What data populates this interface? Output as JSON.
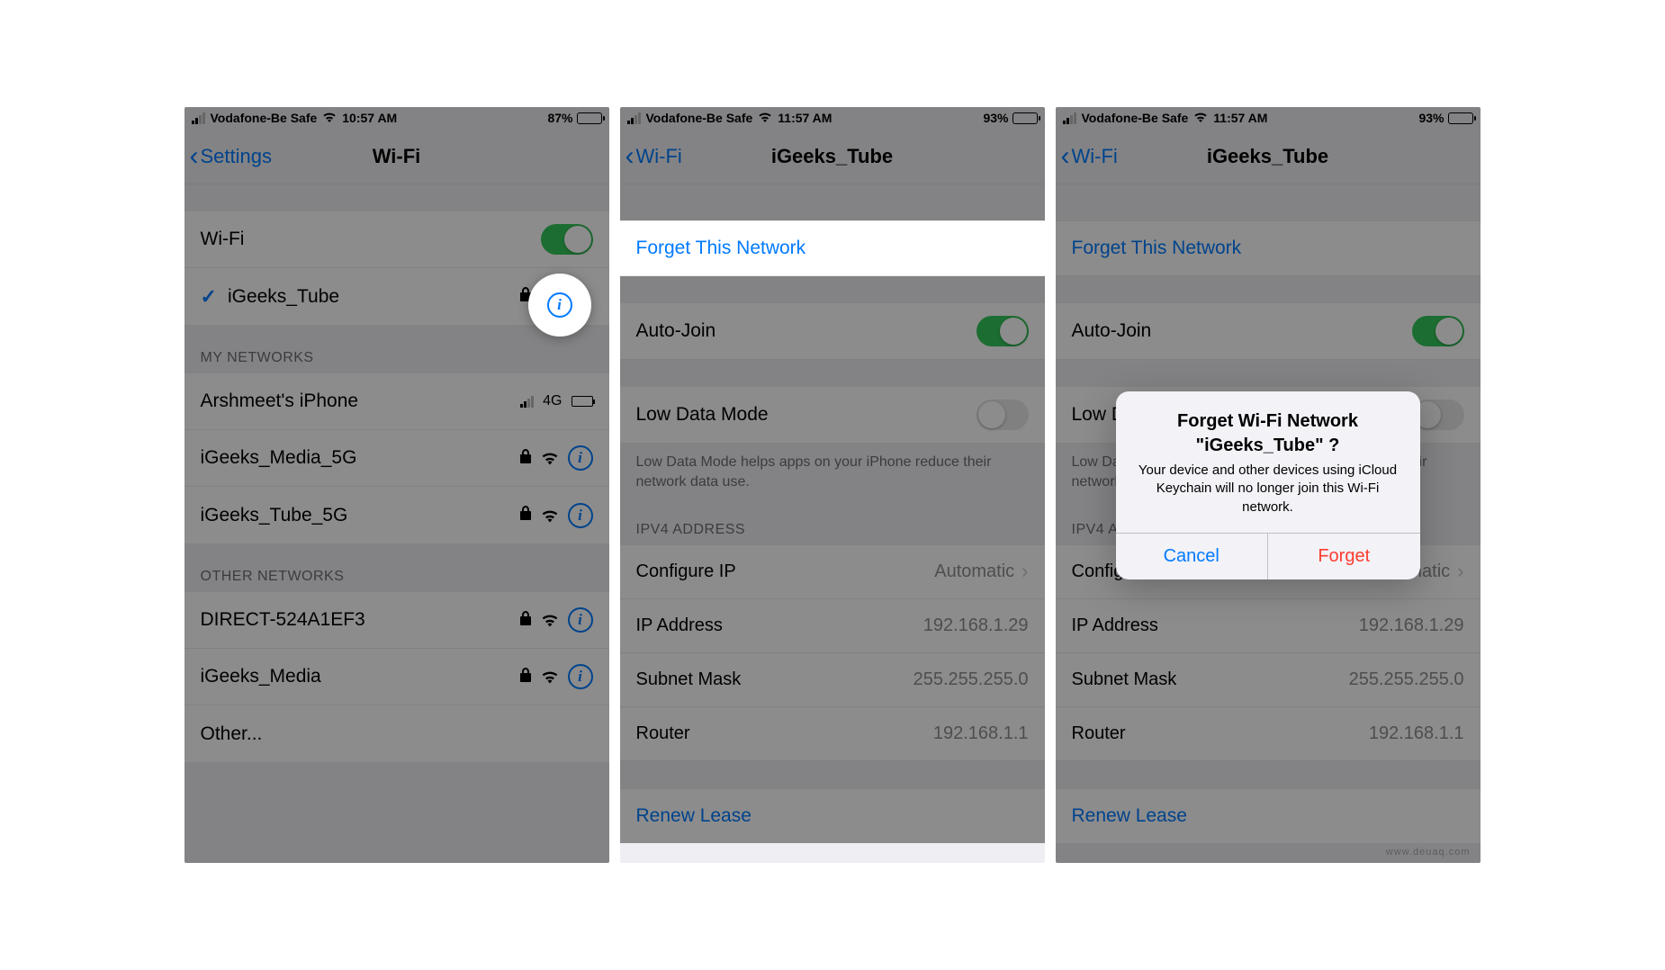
{
  "screen1": {
    "status": {
      "carrier": "Vodafone-Be Safe",
      "time": "10:57 AM",
      "battery": "87%"
    },
    "nav": {
      "back": "Settings",
      "title": "Wi-Fi"
    },
    "wifi_row_label": "Wi-Fi",
    "connected_network": "iGeeks_Tube",
    "section_my": "MY NETWORKS",
    "my_networks": [
      "Arshmeet's iPhone",
      "iGeeks_Media_5G",
      "iGeeks_Tube_5G"
    ],
    "cell_4g": "4G",
    "section_other": "OTHER NETWORKS",
    "other_networks": [
      "DIRECT-524A1EF3",
      "iGeeks_Media",
      "Other..."
    ]
  },
  "screen2": {
    "status": {
      "carrier": "Vodafone-Be Safe",
      "time": "11:57 AM",
      "battery": "93%"
    },
    "nav": {
      "back": "Wi-Fi",
      "title": "iGeeks_Tube"
    },
    "forget": "Forget This Network",
    "auto_join": "Auto-Join",
    "low_data": "Low Data Mode",
    "low_data_desc": "Low Data Mode helps apps on your iPhone reduce their network data use.",
    "ipv4_header": "IPV4 ADDRESS",
    "rows": {
      "configure_ip": {
        "k": "Configure IP",
        "v": "Automatic"
      },
      "ip": {
        "k": "IP Address",
        "v": "192.168.1.29"
      },
      "subnet": {
        "k": "Subnet Mask",
        "v": "255.255.255.0"
      },
      "router": {
        "k": "Router",
        "v": "192.168.1.1"
      }
    },
    "renew": "Renew Lease"
  },
  "screen3": {
    "status": {
      "carrier": "Vodafone-Be Safe",
      "time": "11:57 AM",
      "battery": "93%"
    },
    "nav": {
      "back": "Wi-Fi",
      "title": "iGeeks_Tube"
    },
    "alert": {
      "title": "Forget Wi-Fi Network \"iGeeks_Tube\" ?",
      "message": "Your device and other devices using iCloud Keychain will no longer join this Wi-Fi network.",
      "cancel": "Cancel",
      "forget": "Forget"
    }
  },
  "watermark": "www.deuaq.com"
}
